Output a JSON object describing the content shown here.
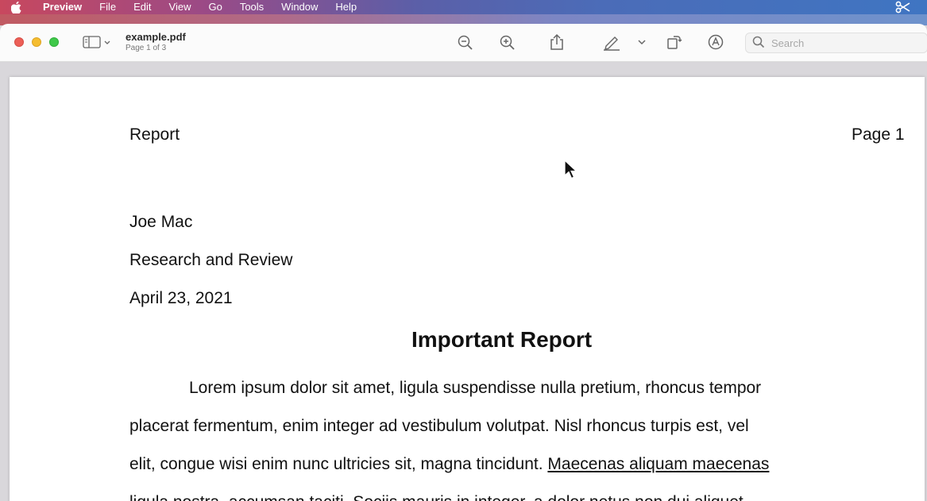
{
  "menubar": {
    "app_name": "Preview",
    "items": [
      "File",
      "Edit",
      "View",
      "Go",
      "Tools",
      "Window",
      "Help"
    ],
    "right_icon": "scissors-icon"
  },
  "toolbar": {
    "doc_title": "example.pdf",
    "doc_subtitle": "Page 1 of 3",
    "search": {
      "placeholder": "Search",
      "value": ""
    },
    "icons": [
      "sidebar-icon",
      "zoom-out-icon",
      "zoom-in-icon",
      "share-icon",
      "markup-pen-icon",
      "chevron-down-icon",
      "rotate-icon",
      "annotate-icon",
      "search-icon"
    ]
  },
  "document": {
    "header_left": "Report",
    "header_right": "Page 1",
    "author": "Joe Mac",
    "department": "Research and Review",
    "date": "April 23, 2021",
    "title": "Important Report",
    "paragraph_lines": [
      "Lorem ipsum dolor sit amet, ligula suspendisse nulla pretium, rhoncus tempor",
      "placerat fermentum, enim integer ad vestibulum volutpat. Nisl rhoncus turpis est, vel",
      "elit, congue wisi enim nunc ultricies sit, magna tincidunt. "
    ],
    "underlined_link": "Maecenas aliquam maecenas",
    "partial_line": "ligula nostra, accumsan taciti. Sociis mauris in integer, a dolor netus non dui aliquet,"
  }
}
